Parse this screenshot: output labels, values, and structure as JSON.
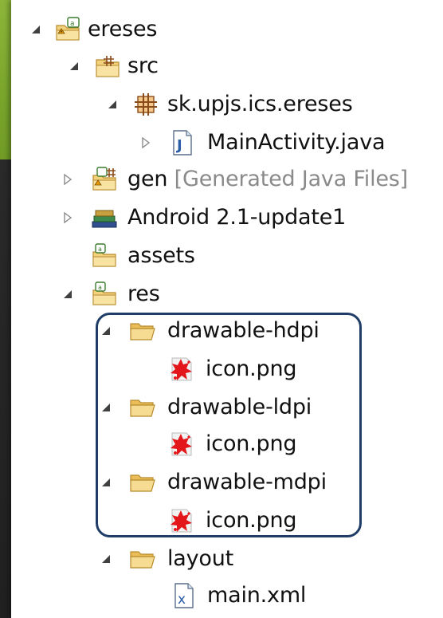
{
  "tree": [
    {
      "id": "ereses",
      "label": "ereses",
      "icon": "android-project-icon",
      "expanded": true
    },
    {
      "id": "src",
      "label": "src",
      "icon": "source-folder-icon",
      "expanded": true
    },
    {
      "id": "package",
      "label": "sk.upjs.ics.ereses",
      "icon": "package-icon",
      "expanded": true
    },
    {
      "id": "mainactivity",
      "label": "MainActivity.java",
      "icon": "java-file-icon",
      "expanded": false
    },
    {
      "id": "gen",
      "label": "gen",
      "decoration": "[Generated Java Files]",
      "icon": "gen-folder-icon",
      "expanded": false
    },
    {
      "id": "android",
      "label": "Android 2.1-update1",
      "icon": "library-icon",
      "expanded": false
    },
    {
      "id": "assets",
      "label": "assets",
      "icon": "folder-icon"
    },
    {
      "id": "res",
      "label": "res",
      "icon": "folder-icon",
      "expanded": true
    },
    {
      "id": "hdpi",
      "label": "drawable-hdpi",
      "icon": "open-folder-icon",
      "expanded": true
    },
    {
      "id": "hdpi_icon",
      "label": "icon.png",
      "icon": "png-image-icon"
    },
    {
      "id": "ldpi",
      "label": "drawable-ldpi",
      "icon": "open-folder-icon",
      "expanded": true
    },
    {
      "id": "ldpi_icon",
      "label": "icon.png",
      "icon": "png-image-icon"
    },
    {
      "id": "mdpi",
      "label": "drawable-mdpi",
      "icon": "open-folder-icon",
      "expanded": true
    },
    {
      "id": "mdpi_icon",
      "label": "icon.png",
      "icon": "png-image-icon"
    },
    {
      "id": "layout",
      "label": "layout",
      "icon": "open-folder-icon",
      "expanded": true
    },
    {
      "id": "mainxml",
      "label": "main.xml",
      "icon": "xml-file-icon"
    }
  ],
  "colors": {
    "highlight_border": "#1f3d66",
    "decoration_text": "#8a8a8a",
    "folder_fill": "#f3d27d",
    "png_red": "#e3171b"
  }
}
